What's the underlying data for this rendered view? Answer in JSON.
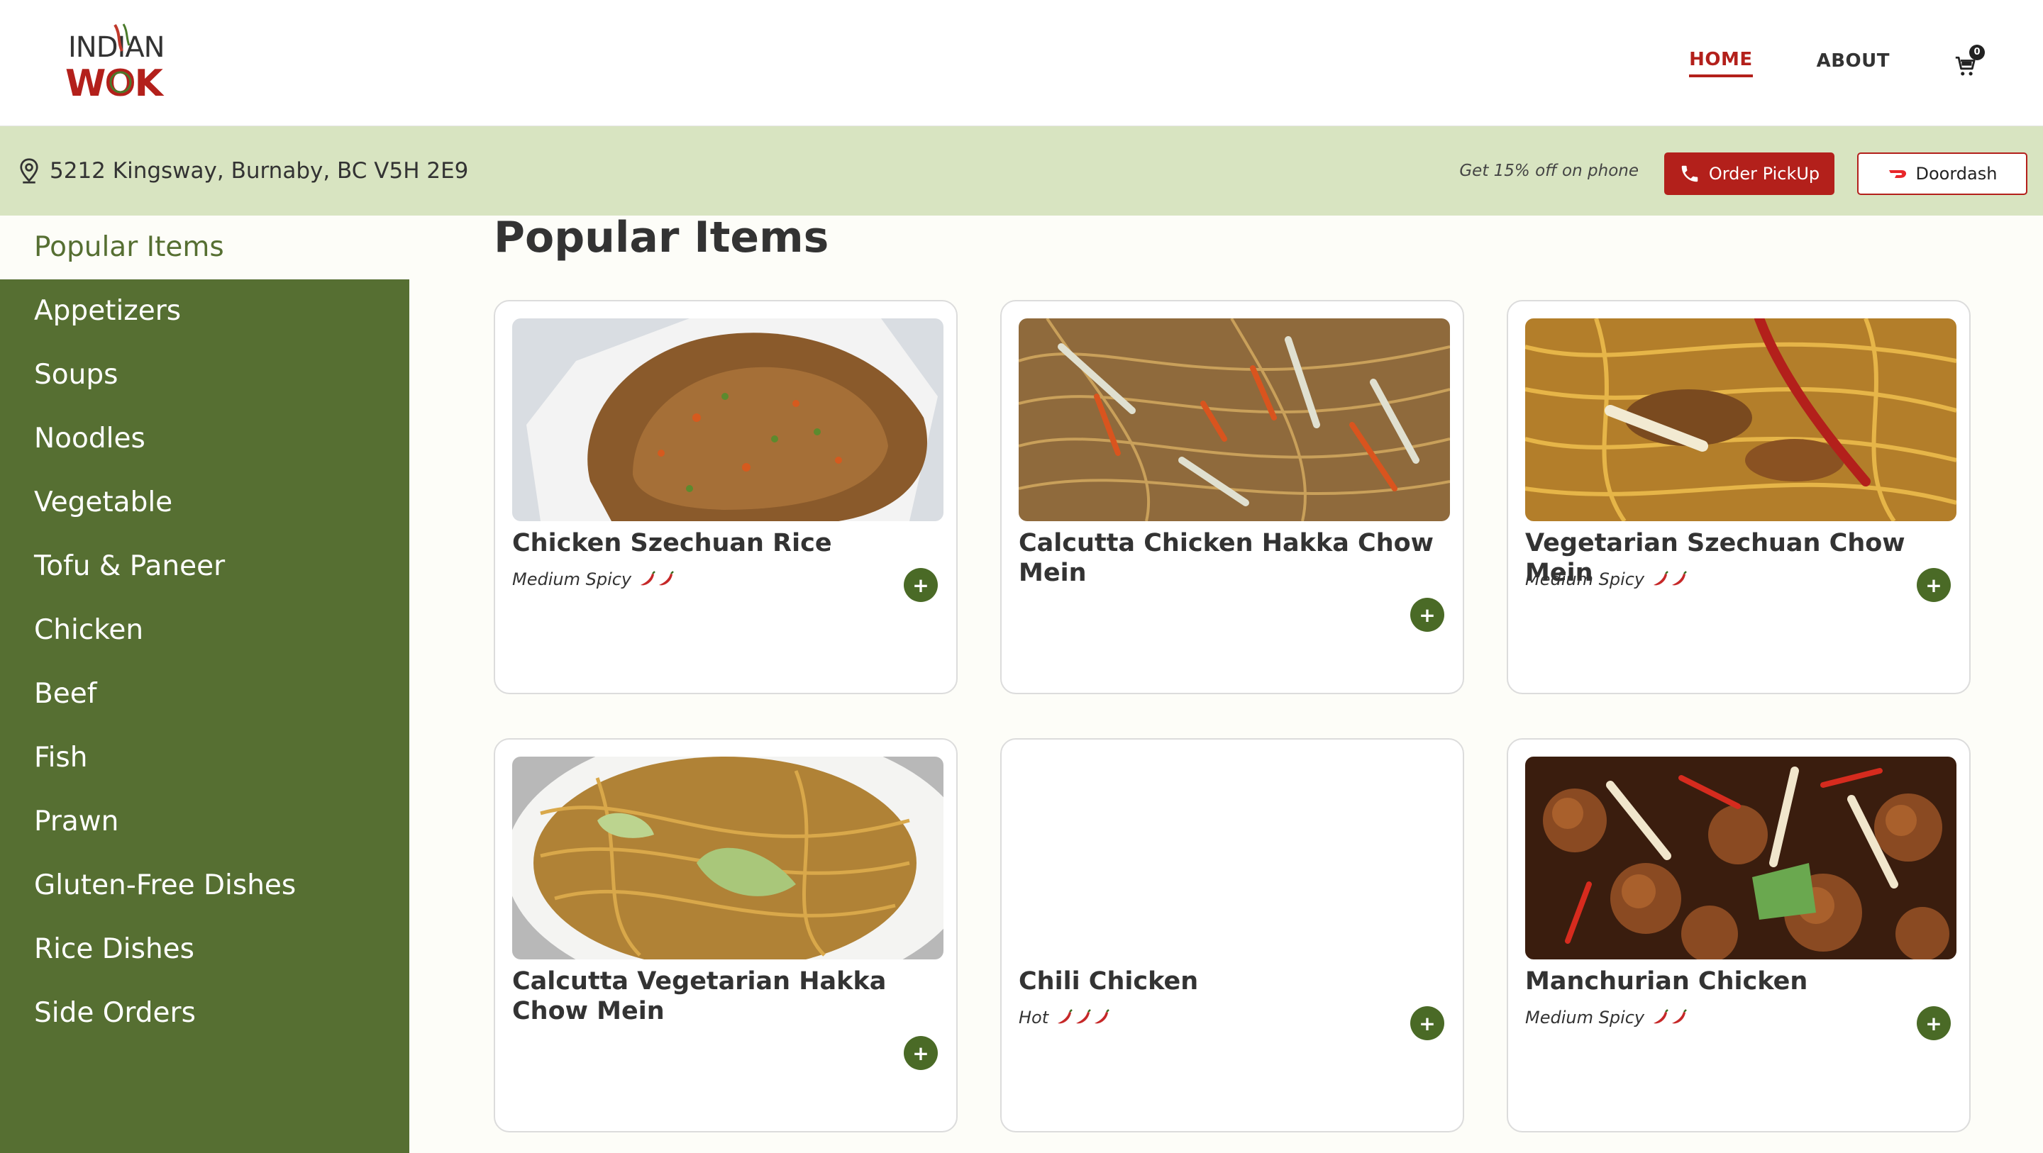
{
  "brand": {
    "logo_line1": "INDIAN",
    "logo_line2": "WOK"
  },
  "nav": {
    "home": "HOME",
    "about": "ABOUT",
    "cart_count": "0"
  },
  "infobar": {
    "address": "5212 Kingsway, Burnaby, BC V5H 2E9",
    "promo": "Get 15% off on phone",
    "pickup_label": "Order PickUp",
    "doordash_label": "Doordash"
  },
  "sidebar": {
    "items": [
      {
        "label": "Popular Items"
      },
      {
        "label": "Appetizers"
      },
      {
        "label": "Soups"
      },
      {
        "label": "Noodles"
      },
      {
        "label": "Vegetable"
      },
      {
        "label": "Tofu & Paneer"
      },
      {
        "label": "Chicken"
      },
      {
        "label": "Beef"
      },
      {
        "label": "Fish"
      },
      {
        "label": "Prawn"
      },
      {
        "label": "Gluten-Free Dishes"
      },
      {
        "label": "Rice Dishes"
      },
      {
        "label": "Side Orders"
      }
    ],
    "active_index": 0
  },
  "main": {
    "title": "Popular Items",
    "cards": [
      {
        "name": "Chicken Szechuan Rice",
        "spice": "Medium Spicy",
        "chilis": 2,
        "image": "fried-rice-photo"
      },
      {
        "name": "Calcutta Chicken Hakka Chow Mein",
        "spice": "",
        "chilis": 0,
        "image": "chow-mein-photo"
      },
      {
        "name": "Vegetarian Szechuan Chow Mein",
        "spice": "Medium Spicy",
        "chilis": 2,
        "image": "szechuan-noodles-photo"
      },
      {
        "name": "Calcutta Vegetarian Hakka Chow Mein",
        "spice": "",
        "chilis": 0,
        "image": "veg-chow-mein-photo"
      },
      {
        "name": "Chili Chicken",
        "spice": "Hot",
        "chilis": 3,
        "image": ""
      },
      {
        "name": "Manchurian Chicken",
        "spice": "Medium Spicy",
        "chilis": 2,
        "image": "manchurian-chicken-photo"
      }
    ],
    "add_label": "+"
  },
  "colors": {
    "brand_red": "#b3201b",
    "sidebar_green": "#566f32",
    "infobar_green": "#d8e4c1",
    "add_button_green": "#4a6a26"
  }
}
